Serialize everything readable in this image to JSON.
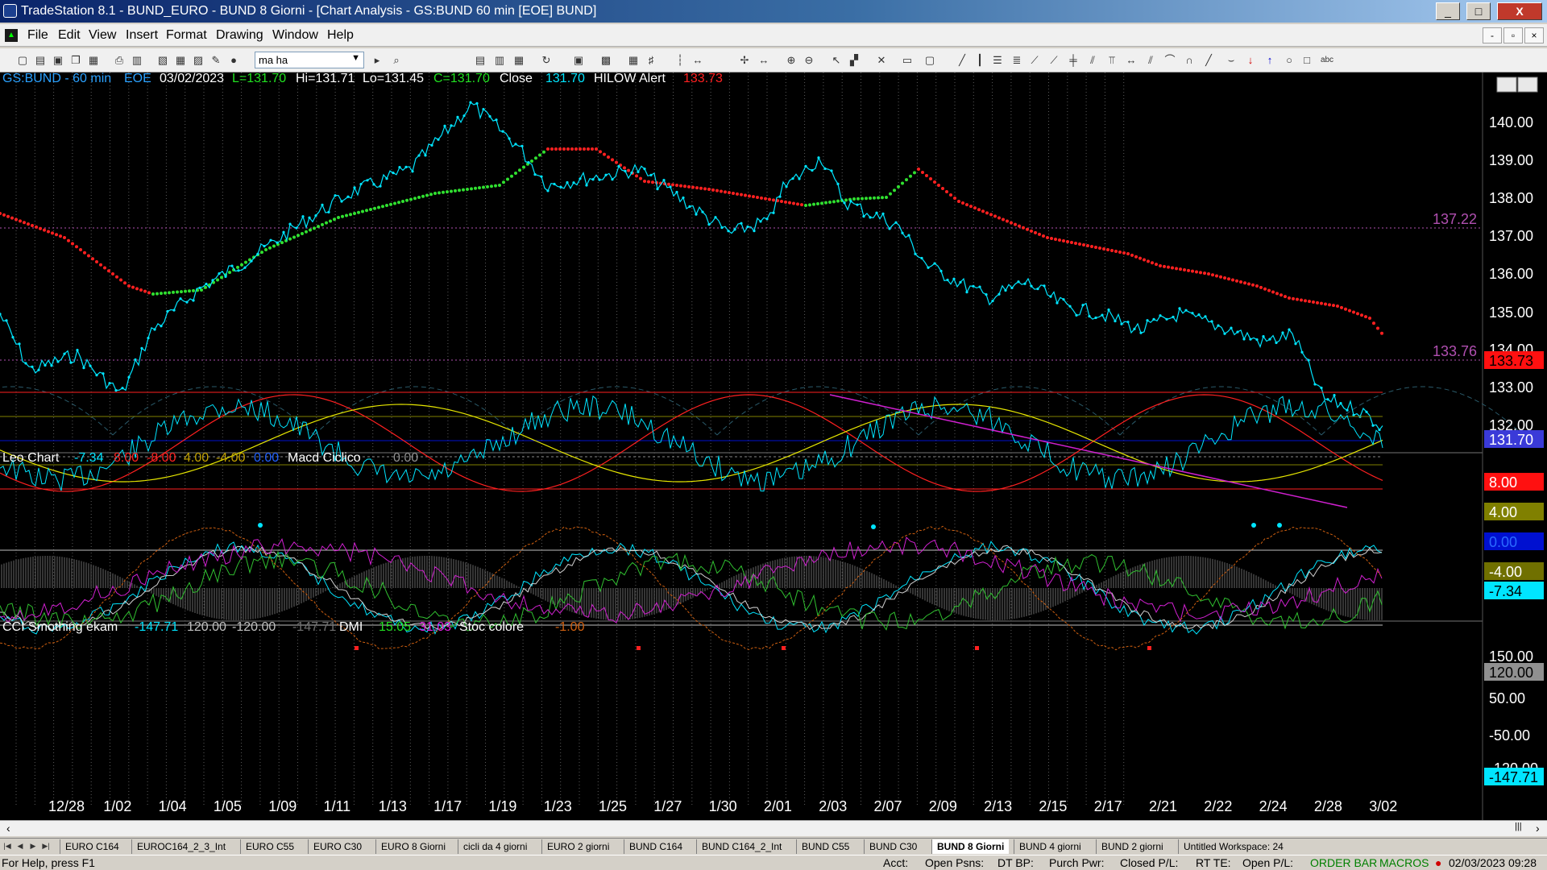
{
  "window": {
    "title": "TradeStation 8.1 - BUND_EURO - BUND 8 Giorni - [Chart Analysis - GS:BUND  60 min  [EOE] BUND]",
    "minimize_glyph": "_",
    "maximize_glyph": "□",
    "close_glyph": "X"
  },
  "menu": {
    "items": [
      "File",
      "Edit",
      "View",
      "Insert",
      "Format",
      "Drawing",
      "Window",
      "Help"
    ],
    "mdi_glyphs": [
      "-",
      "▫",
      "×"
    ]
  },
  "toolbar": {
    "study_select_value": "ma ha",
    "icons": [
      "new-icon",
      "open-icon",
      "save-icon",
      "copy-icon",
      "paste-icon",
      "print-icon",
      "print-preview-icon",
      "chart-icon",
      "grid-icon",
      "lock-icon",
      "hand-icon",
      "globe-icon",
      "zoom-icon",
      "cursor-icon",
      "crosshair-icon",
      "trendline-icon",
      "horizontal-line-icon",
      "arrow-up-icon",
      "arrow-down-icon",
      "circle-icon",
      "rectangle-icon",
      "text-icon"
    ]
  },
  "chart": {
    "header": {
      "symbol": "GS:BUND - 60 min",
      "session": "EOE",
      "date": "03/02/2023",
      "l": "L=131.70",
      "hi": "Hi=131.71",
      "lo": "Lo=131.45",
      "c": "C=131.70",
      "close_label": "Close",
      "close_val": "131.70",
      "alert_label": "HILOW Alert",
      "alert_val": "133.73"
    },
    "price_axis": [
      "140.00",
      "139.00",
      "138.00",
      "137.00",
      "136.00",
      "135.00",
      "134.00",
      "133.00",
      "132.00"
    ],
    "price_tags": {
      "upper_line": "137.22",
      "lower_line": "133.76",
      "alert": "133.73",
      "last": "131.70"
    },
    "sub1_header": {
      "name": "Leo Chart",
      "values": [
        "-7.34",
        "8.00",
        "-8.00",
        "4.00",
        "-4.00",
        "0.00"
      ],
      "macd_name": "Macd Ciclico",
      "macd_val": "0.00"
    },
    "sub1_axis": {
      "p8": "8.00",
      "p4": "4.00",
      "zero": "0.00",
      "m4": "-4.00",
      "last": "-7.34"
    },
    "sub2_header": {
      "name": "CCI Smothing ekam",
      "values": [
        "-147.71",
        "120.00",
        "-120.00",
        "-147.71"
      ],
      "dmi_name": "DMI",
      "dmi_vals": [
        "15.05",
        "31.03"
      ],
      "stoc_name": "Stoc colore",
      "stoc_val": "-1.00"
    },
    "sub2_axis": {
      "p150": "150.00",
      "p120": "120.00",
      "p50": "50.00",
      "m50": "-50.00",
      "m120": "-120.00",
      "last": "-147.71"
    },
    "dates": [
      "12/28",
      "1/02",
      "1/04",
      "1/05",
      "1/09",
      "1/11",
      "1/13",
      "1/17",
      "1/19",
      "1/23",
      "1/25",
      "1/27",
      "1/30",
      "2/01",
      "2/03",
      "2/07",
      "2/09",
      "2/13",
      "2/15",
      "2/17",
      "2/21",
      "2/22",
      "2/24",
      "2/28",
      "3/02"
    ],
    "colors": {
      "price": "#00e5ff",
      "ma_down": "#ff2020",
      "ma_up": "#30e030",
      "grid": "#5a5a5a",
      "purple_line": "#b04fb0",
      "axis_text": "#ffffff",
      "yellow": "#e6e600",
      "magenta": "#d020d0",
      "green": "#30c030",
      "orange": "#d06010"
    }
  },
  "scrollbar": {
    "left_glyph": "‹",
    "right_glyph": "›",
    "end_glyph": "|||"
  },
  "tabs": {
    "nav": [
      "|◀",
      "◀",
      "▶",
      "▶|"
    ],
    "items": [
      "EURO C164",
      "EUROC164_2_3_Int",
      "EURO C55",
      "EURO C30",
      "EURO 8 Giorni",
      "cicli da 4 giorni",
      "EURO 2 giorni",
      "BUND C164",
      "BUND C164_2_Int",
      "BUND C55",
      "BUND  C30",
      "BUND 8 Giorni",
      "BUND 4 giorni",
      "BUND 2 giorni",
      "Untitled Workspace: 24"
    ],
    "active_index": 11
  },
  "status": {
    "help": "For Help, press F1",
    "acct": "Acct:",
    "open_psns": "Open Psns:",
    "dt_bp": "DT BP:",
    "purch_pwr": "Purch Pwr:",
    "closed_pl": "Closed P/L:",
    "rt_te": "RT TE:",
    "open_pl": "Open P/L:",
    "order_bar": "ORDER BAR",
    "macros": "MACROS",
    "datetime": "02/03/2023 09:28"
  }
}
